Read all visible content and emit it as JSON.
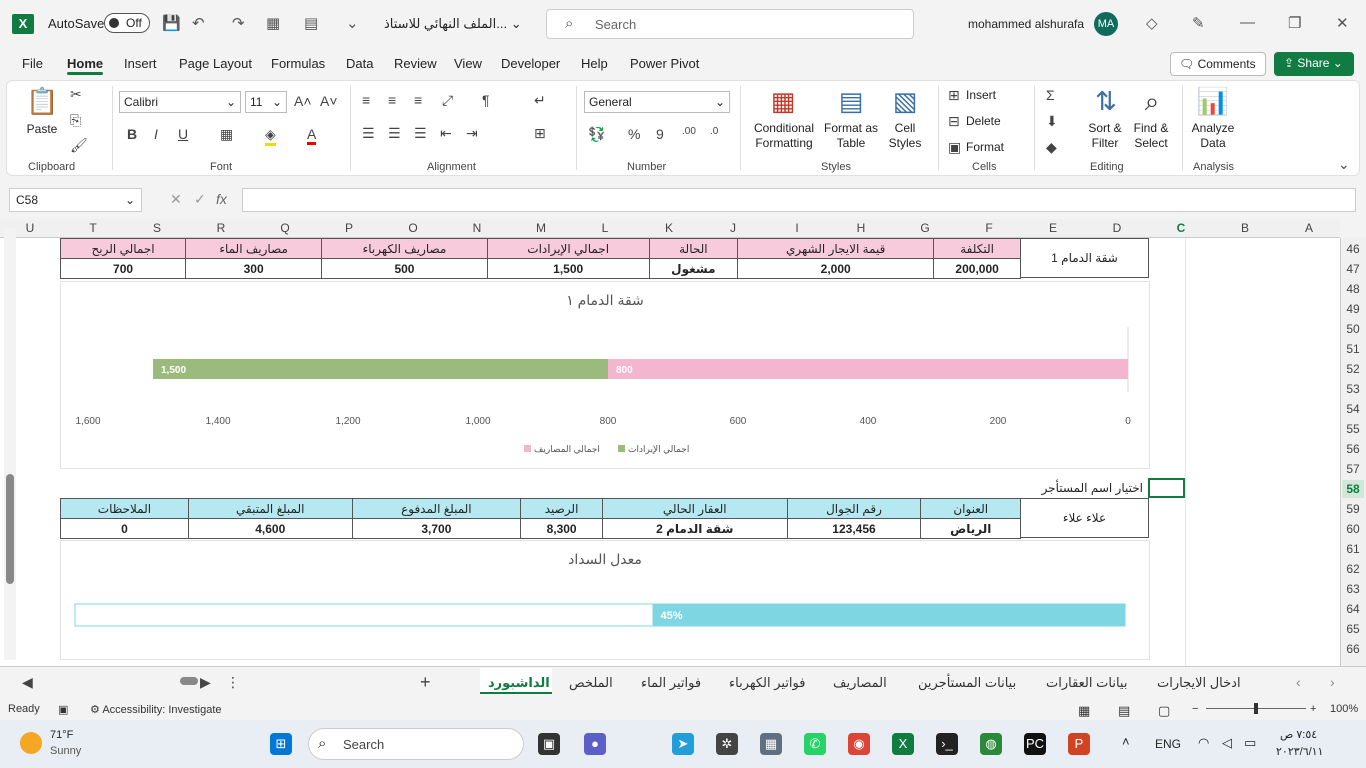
{
  "titlebar": {
    "autosave_label": "AutoSave",
    "autosave_state": "Off",
    "doc_title": "الملف النهائي للاستاذ...",
    "search_placeholder": "Search",
    "user_name": "mohammed alshurafa",
    "user_initials": "MA"
  },
  "ribbon_tabs": [
    "File",
    "Home",
    "Insert",
    "Page Layout",
    "Formulas",
    "Data",
    "Review",
    "View",
    "Developer",
    "Help",
    "Power Pivot"
  ],
  "active_tab": "Home",
  "comments_label": "Comments",
  "share_label": "Share",
  "ribbon": {
    "clipboard": {
      "label": "Clipboard",
      "paste": "Paste"
    },
    "font": {
      "label": "Font",
      "family": "Calibri",
      "size": "11"
    },
    "alignment": {
      "label": "Alignment"
    },
    "number": {
      "label": "Number",
      "format": "General"
    },
    "styles": {
      "label": "Styles",
      "conditional": "Conditional\nFormatting",
      "format_table": "Format as\nTable",
      "cell_styles": "Cell\nStyles"
    },
    "cells": {
      "label": "Cells",
      "insert": "Insert",
      "delete": "Delete",
      "format": "Format"
    },
    "editing": {
      "label": "Editing",
      "sort_filter": "Sort &\nFilter",
      "find_select": "Find &\nSelect"
    },
    "analysis": {
      "label": "Analysis",
      "analyze": "Analyze\nData"
    }
  },
  "formula_bar": {
    "name_box": "C58",
    "fx": "fx",
    "content": ""
  },
  "columns": [
    "U",
    "T",
    "S",
    "R",
    "Q",
    "P",
    "O",
    "N",
    "M",
    "L",
    "K",
    "J",
    "I",
    "H",
    "G",
    "F",
    "E",
    "D",
    "C",
    "B",
    "A"
  ],
  "selected_column": "C",
  "rows": [
    "46",
    "47",
    "48",
    "49",
    "50",
    "51",
    "52",
    "53",
    "54",
    "55",
    "56",
    "57",
    "58",
    "59",
    "60",
    "61",
    "62",
    "63",
    "64",
    "65",
    "66"
  ],
  "selected_row": "58",
  "property_block": {
    "side_label": "شقة الدمام 1",
    "headers": [
      "اجمالي الربح",
      "مصاريف الماء",
      "مصاريف الكهرباء",
      "اجمالي الإيرادات",
      "الحالة",
      "قيمة الايجار الشهري",
      "التكلفة"
    ],
    "values": [
      "700",
      "300",
      "500",
      "1,500",
      "مشغول",
      "2,000",
      "200,000"
    ]
  },
  "chart_data": [
    {
      "type": "bar",
      "orientation": "horizontal",
      "title": "شقة الدمام ١",
      "stacked": true,
      "x_axis_reversed": true,
      "xlim": [
        0,
        1600
      ],
      "ticks": [
        "0",
        "200",
        "400",
        "600",
        "800",
        "1,000",
        "1,200",
        "1,400",
        "1,600"
      ],
      "series": [
        {
          "name": "اجمالي المصاريف",
          "value": 800,
          "label": "800",
          "color": "#f4b6cf"
        },
        {
          "name": "اجمالي الإيرادات",
          "value": 1500,
          "label": "1,500",
          "color": "#9bbb7d"
        }
      ],
      "legend": [
        "اجمالي المصاريف",
        "اجمالي الإيرادات"
      ]
    },
    {
      "type": "bar",
      "orientation": "horizontal",
      "title": "معدل السداد",
      "value": 0.45,
      "label": "45%",
      "color": "#7fd6e3"
    }
  ],
  "tenant_block": {
    "selector_label": "اختيار اسم المستأجر",
    "side_label": "علاء علاء",
    "headers": [
      "الملاحظات",
      "المبلغ المتبقي",
      "المبلغ المدفوع",
      "الرصيد",
      "العقار الحالي",
      "رقم الجوال",
      "العنوان"
    ],
    "values": [
      "0",
      "4,600",
      "3,700",
      "8,300",
      "شقة الدمام 2",
      "123,456",
      "الرياض"
    ]
  },
  "sheet_tabs": [
    "الداشبورد",
    "الملخص",
    "فواتير الماء",
    "فواتير الكهرباء",
    "المصاريف",
    "بيانات المستأجرين",
    "بيانات العقارات",
    "ادخال الايجارات"
  ],
  "active_sheet": "الداشبورد",
  "status": {
    "ready": "Ready",
    "accessibility": "Accessibility: Investigate",
    "zoom": "100%"
  },
  "taskbar": {
    "weather_temp": "71°F",
    "weather_desc": "Sunny",
    "search": "Search",
    "lang": "ENG",
    "time": "٧:٥٤ ص",
    "date": "٢٠٢٣/٦/١١"
  }
}
